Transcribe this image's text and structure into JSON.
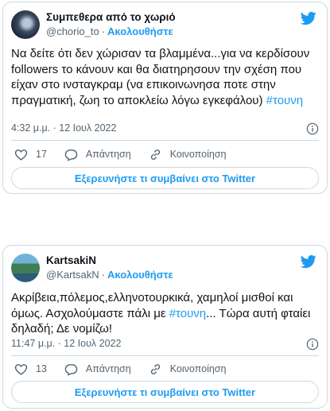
{
  "colors": {
    "accent": "#1d9bf0",
    "text": "#0f1419",
    "muted": "#536471",
    "border": "#cfd9de"
  },
  "tweets": [
    {
      "author_name": "Συμπεθερα από το χωριό",
      "handle": "@chorio_to",
      "separator": "·",
      "follow_label": "Ακολουθήστε",
      "text_before": "Να δείτε ότι δεν χώρισαν τα βλαμμένα...για να κερδίσουν followers το κάνουν και θα  διατηρησουν την σχέση που είχαν στο ινσταγκραμ (να επικοινωνησα ποτε στην πραγματική, ζωη το αποκλείω λόγω εγκεφάλου) ",
      "hashtag": "#τουνη",
      "text_after": "",
      "time": "4:32 μ.μ. · 12 Ιουλ 2022",
      "likes": "17",
      "reply_label": "Απάντηση",
      "share_label": "Κοινοποίηση",
      "explore_label": "Εξερευνήστε τι συμβαίνει στο Twitter",
      "avatar_icon": "avatar-image",
      "brand_icon": "twitter-bird-icon"
    },
    {
      "author_name": "KartsakiN",
      "handle": "@KartsakN",
      "separator": "·",
      "follow_label": "Ακολουθήστε",
      "text_before": "Ακρίβεια,πόλεμος,ελληνοτουρκικά, χαμηλοί μισθοί και όμως. Ασχολούμαστε πάλι με ",
      "hashtag": "#τουνη",
      "text_after": "... Τώρα αυτή φταίει δηλαδή; Δε νομίζω!",
      "time": "11:47 μ.μ. · 12 Ιουλ 2022",
      "likes": "13",
      "reply_label": "Απάντηση",
      "share_label": "Κοινοποίηση",
      "explore_label": "Εξερευνήστε τι συμβαίνει στο Twitter",
      "avatar_icon": "avatar-image",
      "brand_icon": "twitter-bird-icon"
    }
  ]
}
